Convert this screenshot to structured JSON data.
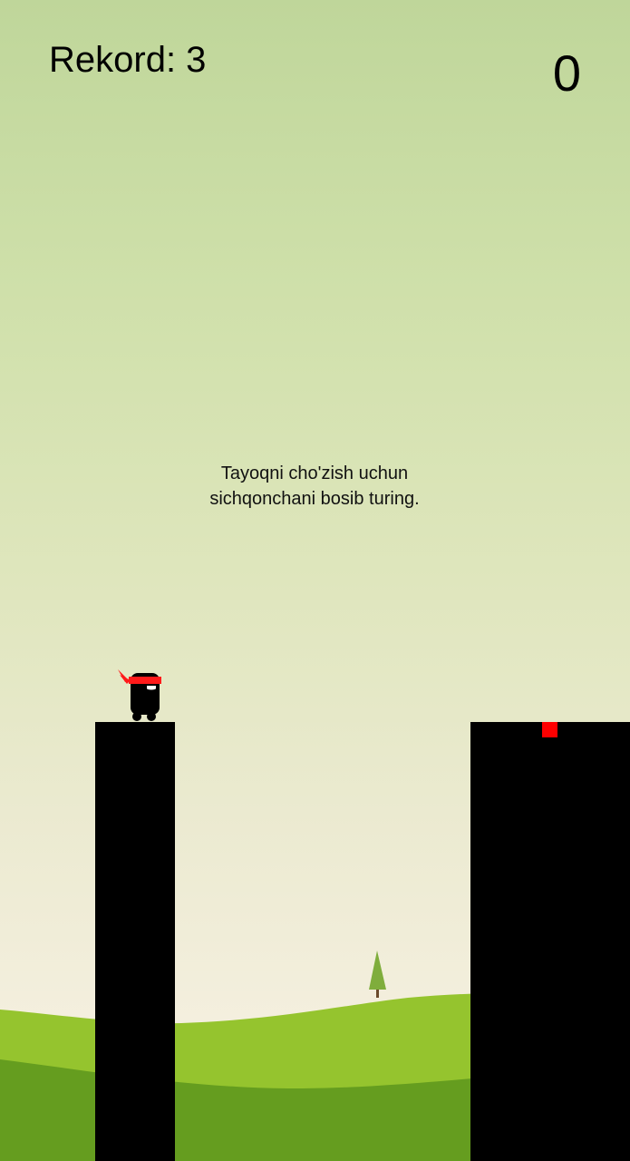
{
  "hud": {
    "record_text": "Rekord: 3",
    "score": "0"
  },
  "instructions": {
    "line1": "Tayoqni cho'zish uchun",
    "line2": "sichqonchani bosib turing."
  },
  "colors": {
    "sky_top": "#bfd69a",
    "sky_bottom": "#f5efdf",
    "hill_light": "#95c42e",
    "hill_dark": "#659d1f",
    "pillar": "#000000",
    "target": "#ff0000",
    "headband": "#ff1a1a"
  },
  "icons": {
    "player": "ninja-hero-icon",
    "tree": "pine-tree-icon"
  }
}
